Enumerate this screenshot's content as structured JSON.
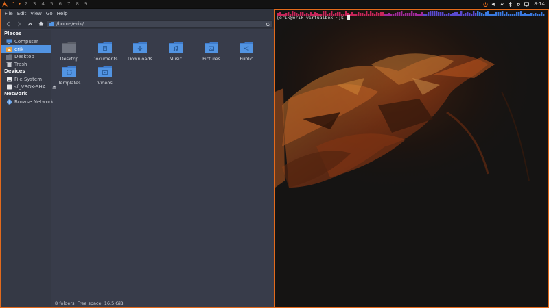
{
  "panel": {
    "workspaces": [
      "1",
      "2",
      "3",
      "4",
      "5",
      "6",
      "7",
      "8",
      "9"
    ],
    "active_workspace": "1",
    "layout_marker": "▸",
    "tray_icons": [
      "power-icon",
      "volume-icon",
      "network-icon",
      "bluetooth-icon",
      "settings-icon",
      "display-icon"
    ],
    "clock": "8:14"
  },
  "file_manager": {
    "menu": [
      "File",
      "Edit",
      "View",
      "Go",
      "Help"
    ],
    "location": "/home/erik/",
    "sidebar": {
      "places_heading": "Places",
      "places": [
        {
          "label": "Computer",
          "icon": "computer-icon"
        },
        {
          "label": "erik",
          "icon": "home-folder-icon",
          "selected": true
        },
        {
          "label": "Desktop",
          "icon": "desktop-folder-icon"
        },
        {
          "label": "Trash",
          "icon": "trash-icon"
        }
      ],
      "devices_heading": "Devices",
      "devices": [
        {
          "label": "File System",
          "icon": "drive-icon"
        },
        {
          "label": "sf_VBOX-SHA...",
          "icon": "drive-icon",
          "eject": true
        }
      ],
      "network_heading": "Network",
      "network": [
        {
          "label": "Browse Network",
          "icon": "globe-icon"
        }
      ]
    },
    "files": [
      {
        "label": "Desktop",
        "icon": "desktop-folder-icon"
      },
      {
        "label": "Documents",
        "icon": "documents-folder-icon"
      },
      {
        "label": "Downloads",
        "icon": "downloads-folder-icon"
      },
      {
        "label": "Music",
        "icon": "music-folder-icon"
      },
      {
        "label": "Pictures",
        "icon": "pictures-folder-icon"
      },
      {
        "label": "Public",
        "icon": "public-folder-icon"
      },
      {
        "label": "Templates",
        "icon": "templates-folder-icon"
      },
      {
        "label": "Videos",
        "icon": "videos-folder-icon"
      }
    ],
    "status": "8 folders, Free space: 16.5 GiB"
  },
  "terminal": {
    "prompt": "[erik@erik-virtualbox ~]$ "
  },
  "colors": {
    "accent": "#e26a1c",
    "selection": "#5294e2",
    "folder": "#5294e2"
  }
}
